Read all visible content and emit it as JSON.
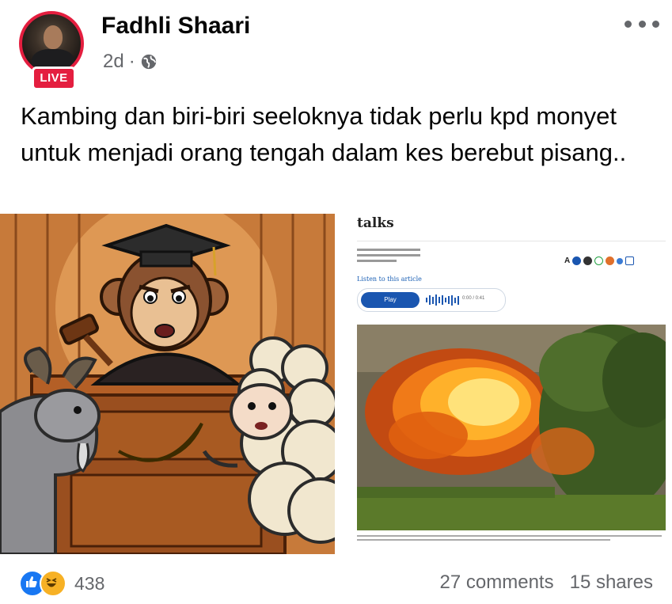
{
  "post": {
    "author": "Fadhli Shaari",
    "live_badge": "LIVE",
    "time_ago": "2d",
    "separator": "·",
    "audience_icon": "globe-icon",
    "more_icon": "more-options-icon",
    "caption": "Kambing dan biri-biri seeloknya tidak perlu kpd monyet untuk menjadi orang tengah dalam kes berebut pisang.."
  },
  "media": {
    "comic_icon": "courtroom-comic-illustration",
    "article": {
      "title": "talks",
      "listen_label": "Listen to this article",
      "play_label": "Play",
      "time": "0:00 / 0:41",
      "text_size_label": "A",
      "share_colors": [
        "#1a56b0",
        "#333333",
        "#e0702b",
        "#25a244",
        "#1a56b0",
        "#3a7bd5"
      ]
    }
  },
  "footer": {
    "reaction_icons": [
      "like-icon",
      "haha-icon"
    ],
    "reaction_count": "438",
    "comments": "27 comments",
    "shares": "15 shares"
  },
  "colors": {
    "live_red": "#e41e3f",
    "facebook_blue": "#1877f2",
    "secondary_text": "#65676b"
  }
}
